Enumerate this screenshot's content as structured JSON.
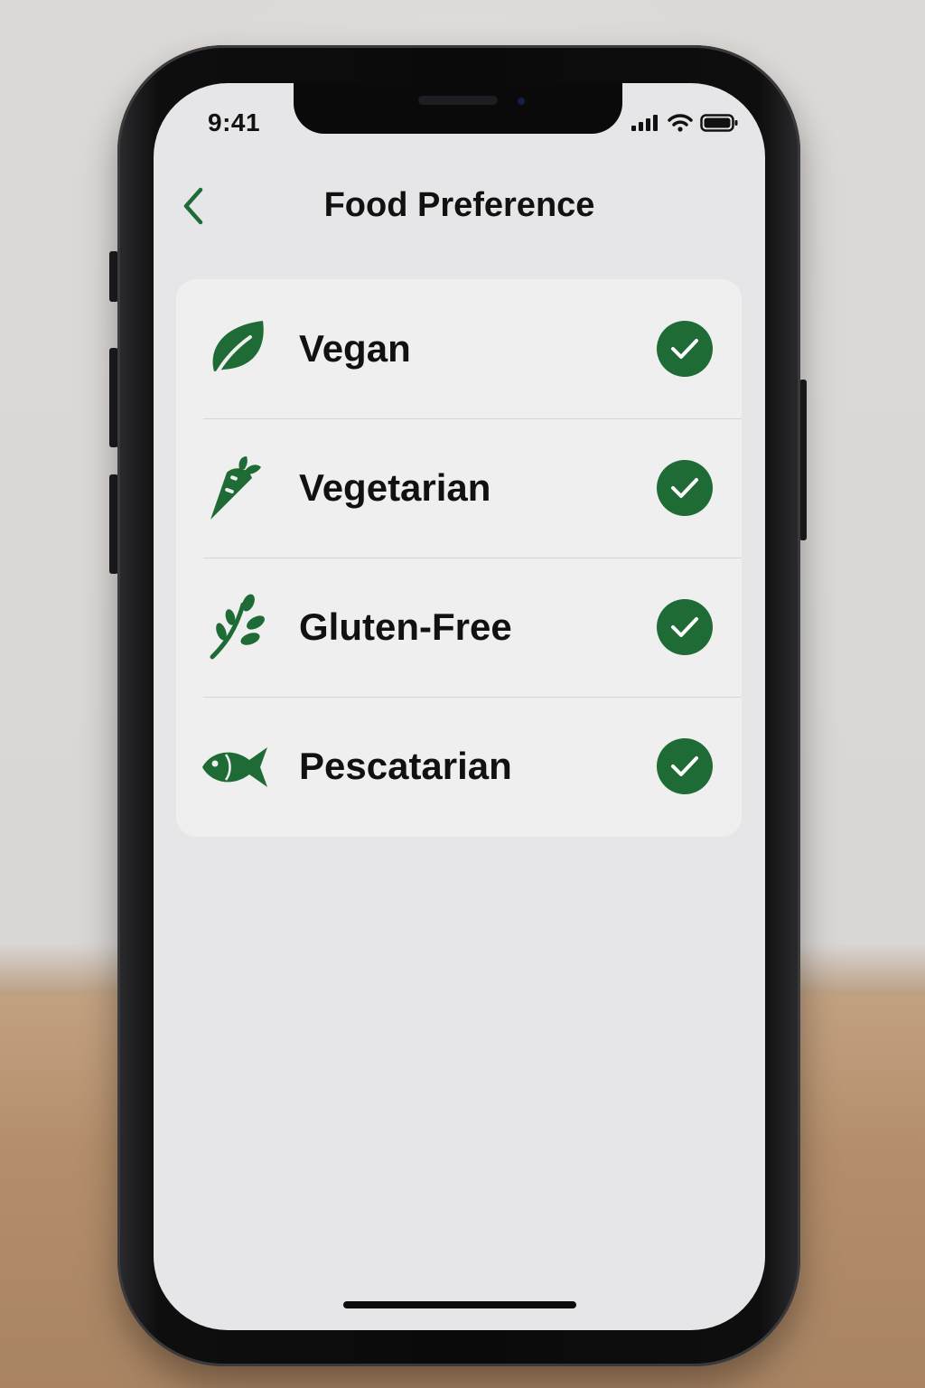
{
  "status_bar": {
    "time": "9:41"
  },
  "nav": {
    "title": "Food Preference"
  },
  "accent_color": "#1e6b35",
  "preferences": [
    {
      "label": "Vegan",
      "icon": "leaf-icon",
      "checked": true
    },
    {
      "label": "Vegetarian",
      "icon": "carrot-icon",
      "checked": true
    },
    {
      "label": "Gluten-Free",
      "icon": "wheat-icon",
      "checked": true
    },
    {
      "label": "Pescatarian",
      "icon": "fish-icon",
      "checked": true
    }
  ]
}
